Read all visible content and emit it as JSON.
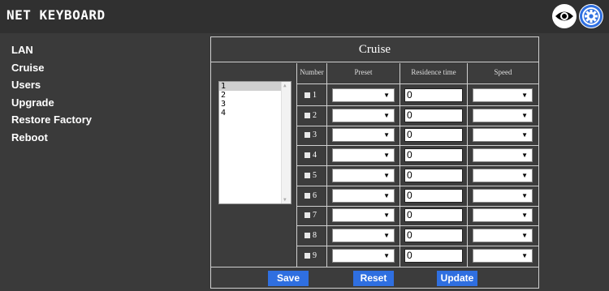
{
  "app": {
    "title": "NET KEYBOARD",
    "eye_icon": "eye-icon",
    "gear_icon": "gear-icon",
    "accent": "#2f6fe0"
  },
  "sidebar": {
    "items": [
      {
        "label": "LAN"
      },
      {
        "label": "Cruise"
      },
      {
        "label": "Users"
      },
      {
        "label": "Upgrade"
      },
      {
        "label": "Restore Factory"
      },
      {
        "label": "Reboot"
      }
    ]
  },
  "panel": {
    "title": "Cruise",
    "routes": [
      "1",
      "2",
      "3",
      "4"
    ],
    "selected_route": "1",
    "columns": [
      "Number",
      "Preset",
      "Residence time",
      "Speed"
    ],
    "rows": [
      {
        "number": "1",
        "residence": "0"
      },
      {
        "number": "2",
        "residence": "0"
      },
      {
        "number": "3",
        "residence": "0"
      },
      {
        "number": "4",
        "residence": "0"
      },
      {
        "number": "5",
        "residence": "0"
      },
      {
        "number": "6",
        "residence": "0"
      },
      {
        "number": "7",
        "residence": "0"
      },
      {
        "number": "8",
        "residence": "0"
      },
      {
        "number": "9",
        "residence": "0"
      }
    ]
  },
  "buttons": {
    "save": "Save",
    "reset": "Reset",
    "update": "Update"
  }
}
